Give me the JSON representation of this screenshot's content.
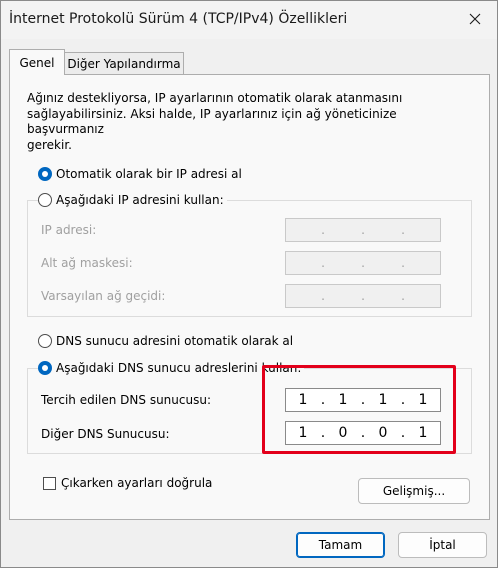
{
  "window": {
    "title": "İnternet Protokolü Sürüm 4 (TCP/IPv4) Özellikleri"
  },
  "tabs": [
    {
      "label": "Genel",
      "active": true
    },
    {
      "label": "Diğer Yapılandırma",
      "active": false
    }
  ],
  "description": {
    "line1": "Ağınız destekliyorsa, IP ayarlarının otomatik olarak atanmasını",
    "line2": "sağlayabilirsiniz. Aksi halde, IP ayarlarınız için ağ yöneticinize başvurmanız",
    "line3": "gerekir."
  },
  "ip": {
    "auto_label": "Otomatik olarak bir IP adresi al",
    "auto_selected": true,
    "manual_label": "Aşağıdaki IP adresini kullan:",
    "address_label": "IP adresi:",
    "mask_label": "Alt ağ maskesi:",
    "gateway_label": "Varsayılan ağ geçidi:"
  },
  "dns": {
    "auto_label": "DNS sunucu adresini otomatik olarak al",
    "manual_label": "Aşağıdaki DNS sunucu adreslerini kullan:",
    "manual_selected": true,
    "preferred_label": "Tercih edilen DNS sunucusu:",
    "preferred_octets": [
      "1",
      "1",
      "1",
      "1"
    ],
    "alternate_label": "Diğer DNS Sunucusu:",
    "alternate_octets": [
      "1",
      "0",
      "0",
      "1"
    ]
  },
  "validate_label": "Çıkarken ayarları doğrula",
  "buttons": {
    "advanced": "Gelişmiş...",
    "ok": "Tamam",
    "cancel": "İptal"
  },
  "colors": {
    "accent": "#0067c0",
    "highlight": "#e3001b"
  }
}
